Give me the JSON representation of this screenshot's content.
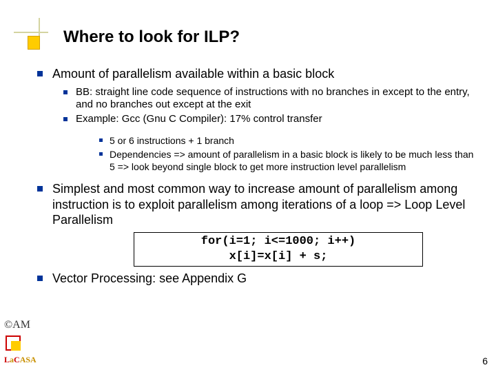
{
  "title": "Where to look for ILP?",
  "bullets": {
    "p1": "Amount of parallelism available within a basic block",
    "p1a": "BB: straight line code sequence of instructions with no branches in except to the entry, and no branches out except at the exit",
    "p1b": "Example: Gcc (Gnu C Compiler): 17% control transfer",
    "p1b1": "5 or 6 instructions + 1 branch",
    "p1b2": "Dependencies => amount of parallelism in a basic block is likely to be much less than 5 => look beyond single block to get more instruction level parallelism",
    "p2": "Simplest and most common way to increase amount of parallelism among instruction is to exploit parallelism among iterations of a loop => Loop Level Parallelism",
    "p3": "Vector Processing: see Appendix G"
  },
  "code": {
    "line1": "for(i=1; i<=1000; i++)",
    "line2": "x[i]=x[i] + s;"
  },
  "footer": {
    "copyright": "©AM",
    "brand_l": "L",
    "brand_a1": "a",
    "brand_c": "C",
    "brand_a2": "A",
    "brand_s": "S",
    "brand_a3": "A"
  },
  "page_number": "6"
}
